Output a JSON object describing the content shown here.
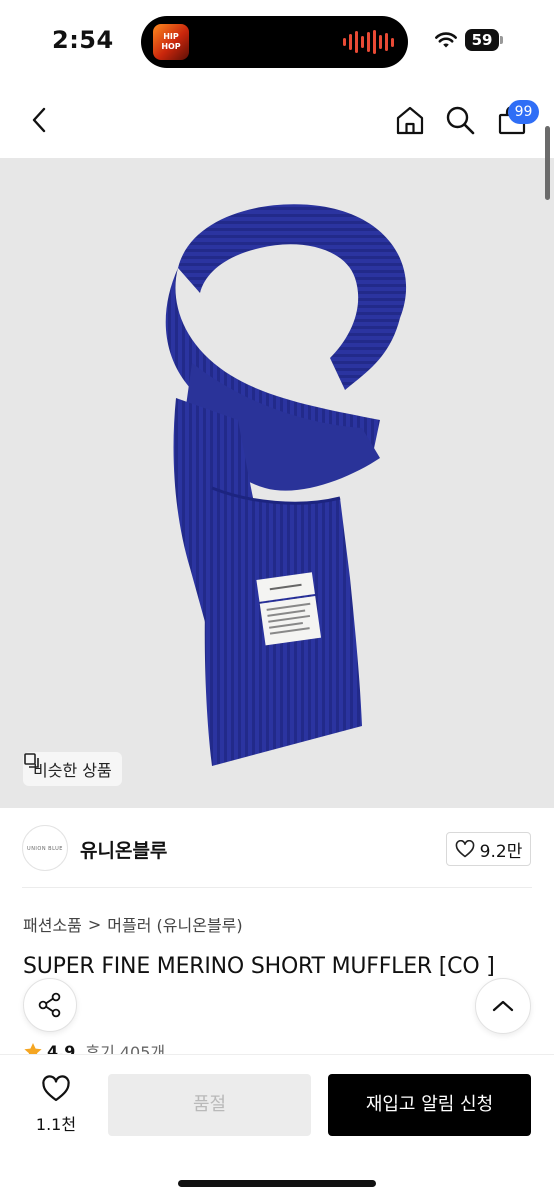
{
  "status_bar": {
    "time": "2:54",
    "now_playing_art_text": "HIP HOP",
    "battery": "59"
  },
  "header": {
    "icons": [
      "chevron-left-icon",
      "home-icon",
      "search-icon",
      "cart-icon"
    ],
    "cart_badge": "99"
  },
  "hero": {
    "similar_label": "비슷한 상품"
  },
  "brand": {
    "logo_text": "UNION BLUE",
    "name": "유니온블루",
    "likes": "9.2만"
  },
  "breadcrumb": {
    "category": "패션소품",
    "separator": ">",
    "subcategory": "머플러 (유니온블루)"
  },
  "product": {
    "title": "SUPER FINE MERINO SHORT MUFFLER [CO ]",
    "rating": "4.9",
    "reviews": "후기 405개"
  },
  "bottom_bar": {
    "wish_count": "1.1천",
    "soldout_label": "품절",
    "restock_label": "재입고 알림 신청"
  },
  "colors": {
    "accent_badge": "#2f6ef6",
    "star": "#f5a623",
    "scarf": "#27309a"
  }
}
